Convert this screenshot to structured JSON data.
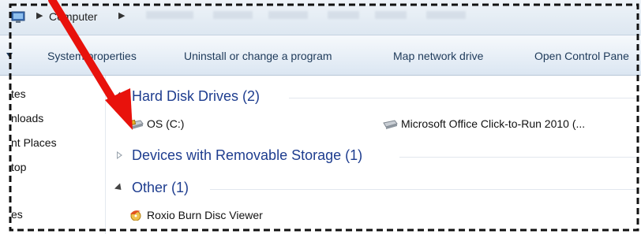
{
  "address": {
    "crumb": "Computer"
  },
  "toolbar": {
    "items": [
      {
        "label": "System properties"
      },
      {
        "label": "Uninstall or change a program"
      },
      {
        "label": "Map network drive"
      },
      {
        "label": "Open Control Pane"
      }
    ]
  },
  "sidebar": {
    "items": [
      {
        "label": "tes"
      },
      {
        "label": "nloads"
      },
      {
        "label": "nt Places"
      },
      {
        "label": "top"
      },
      {
        "label": "es"
      }
    ]
  },
  "groups": {
    "hdd": {
      "title": "Hard Disk Drives (2)",
      "items": [
        "OS (C:)",
        "Microsoft Office Click-to-Run 2010 (..."
      ]
    },
    "removable": {
      "title": "Devices with Removable Storage (1)"
    },
    "other": {
      "title": "Other (1)",
      "items": [
        "Roxio Burn Disc Viewer"
      ]
    }
  },
  "annotation": {
    "arrow_color": "#e8120c",
    "dash_color": "#111111"
  }
}
